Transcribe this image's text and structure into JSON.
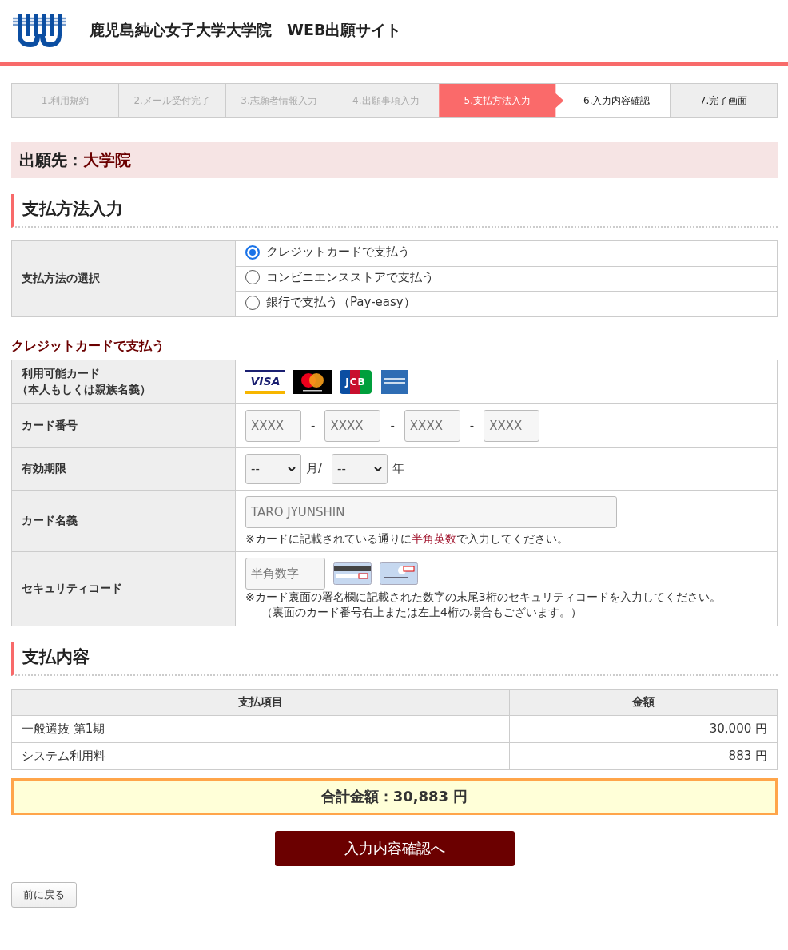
{
  "header": {
    "title": "鹿児島純心女子大学大学院　WEB出願サイト"
  },
  "steps": [
    {
      "label": "1.利用規約",
      "selected": false,
      "completed": true
    },
    {
      "label": "2.メール受付完了",
      "selected": false,
      "completed": true
    },
    {
      "label": "3.志願者情報入力",
      "selected": false,
      "completed": true
    },
    {
      "label": "4.出願事項入力",
      "selected": false,
      "completed": true
    },
    {
      "label": "5.支払方法入力",
      "selected": true,
      "completed": false
    },
    {
      "label": "6.入力内容確認",
      "selected": false,
      "completed": false
    },
    {
      "label": "7.完了画面",
      "selected": false,
      "completed": false
    }
  ],
  "destination": {
    "label": "出願先：",
    "value": "大学院"
  },
  "payment_method": {
    "heading": "支払方法入力",
    "label": "支払方法の選択",
    "options": [
      {
        "label": "クレジットカードで支払う",
        "selected": true
      },
      {
        "label": "コンビニエンスストアで支払う",
        "selected": false
      },
      {
        "label": "銀行で支払う（Pay-easy）",
        "selected": false
      }
    ]
  },
  "credit_card": {
    "heading": "クレジットカードで支払う",
    "cards_label": [
      "利用可能カード",
      "（本人もしくは親族名義）"
    ],
    "cards": [
      {
        "kind": "visa",
        "label": "VISA"
      },
      {
        "kind": "mastercard"
      },
      {
        "kind": "jcb",
        "label": "JCB"
      },
      {
        "kind": "amex"
      }
    ],
    "number_label": "カード番号",
    "number_fields": [
      {
        "placeholder": "XXXX"
      },
      {
        "placeholder": "XXXX"
      },
      {
        "placeholder": "XXXX"
      },
      {
        "placeholder": "XXXX"
      }
    ],
    "separator": "-",
    "expiry_label": "有効期限",
    "month_value": "--",
    "month_unit": "月/",
    "year_value": "--",
    "year_unit": "年",
    "name_label": "カード名義",
    "name_placeholder": "TARO JYUNSHIN",
    "name_note": [
      {
        "text": "※カードに記載されている通りに",
        "emphasis": false
      },
      {
        "text": "半角英数",
        "emphasis": true
      },
      {
        "text": "で入力してください。",
        "emphasis": false
      }
    ],
    "security_label": "セキュリティコード",
    "security_placeholder": "半角数字",
    "security_notes": [
      "※カード裏面の署名欄に記載された数字の末尾3桁のセキュリティコードを入力してください。",
      "（裏面のカード番号右上または左上4桁の場合もございます。）"
    ]
  },
  "payment_details": {
    "heading": "支払内容",
    "columns": [
      "支払項目",
      "金額"
    ],
    "rows": [
      {
        "item": "一般選抜 第1期",
        "amount": "30,000 円"
      },
      {
        "item": "システム利用料",
        "amount": "883 円"
      }
    ],
    "total": "合計金額：30,883 円"
  },
  "buttons": {
    "confirm": "入力内容確認へ",
    "back": "前に戻る"
  }
}
